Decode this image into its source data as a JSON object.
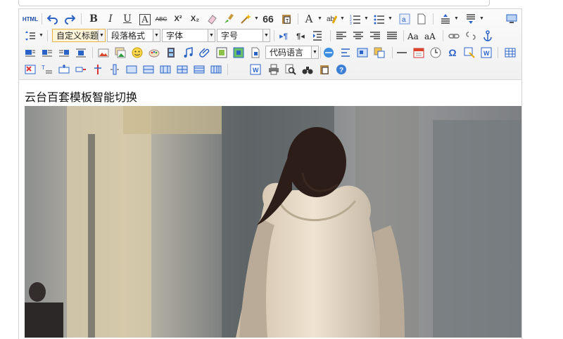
{
  "toolbar": {
    "html_label": "HTML",
    "bold": "B",
    "italic": "I",
    "underline": "U",
    "font_color": "A",
    "strike": "ABC",
    "sup": "X²",
    "sub": "X₂",
    "quote": "66",
    "row2": {
      "custom_title": "自定义标题",
      "paragraph_format": "段落格式",
      "font_family": "字体",
      "font_size": "字号",
      "ltr": "▸¶",
      "rtl": "¶◂"
    },
    "row3": {
      "code_language": "代码语言",
      "omega": "Ω"
    }
  },
  "content": {
    "heading": "云台百套模板智能切换"
  },
  "colors": {
    "accent_blue": "#2b62c6",
    "toolbar_bg": "#f3f3f3",
    "highlight_combo": "#fff6d9"
  }
}
